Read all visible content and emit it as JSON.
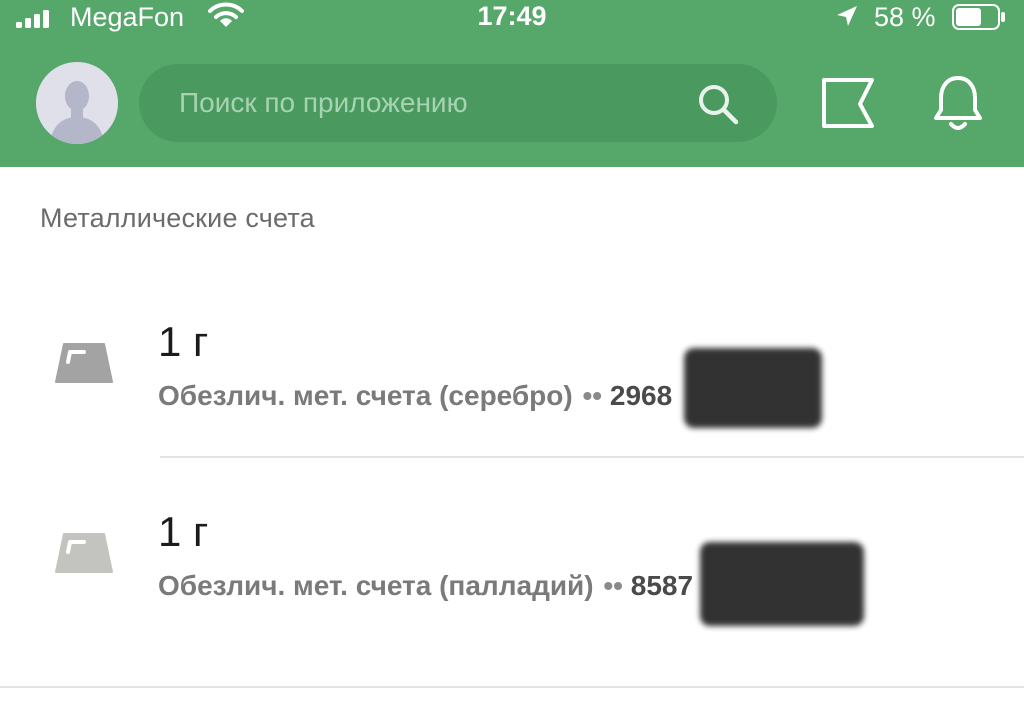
{
  "status_bar": {
    "carrier": "MegaFon",
    "time": "17:49",
    "battery_percent": "58 %",
    "icons": [
      "signal-icon",
      "wifi-icon",
      "location-arrow-icon",
      "battery-icon"
    ]
  },
  "header": {
    "search_placeholder": "Поиск по приложению",
    "icons": [
      "avatar",
      "search-icon",
      "flag-icon",
      "bell-icon"
    ]
  },
  "section": {
    "title": "Металлические счета"
  },
  "accounts": [
    {
      "amount": "1 г",
      "description": "Обезлич. мет. счета (серебро)",
      "dots": "••",
      "number": "2968",
      "icon": "silver-ingot-icon",
      "icon_color": "#a3a3a3"
    },
    {
      "amount": "1 г",
      "description": "Обезлич. мет. счета (палладий)",
      "dots": "••",
      "number": "8587",
      "icon": "palladium-ingot-icon",
      "icon_color": "#c3c3c0"
    }
  ],
  "colors": {
    "header_bg": "#55a76a",
    "search_bg": "#4a9a5f"
  }
}
